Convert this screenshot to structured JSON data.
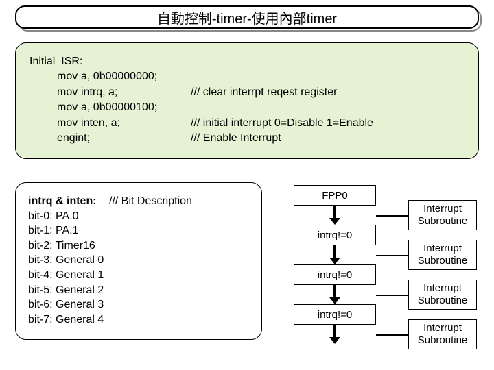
{
  "title": "自動控制-timer-使用內部timer",
  "code": {
    "label": "Initial_ISR:",
    "lines": [
      {
        "op": "mov",
        "arg": "a, 0b00000000;",
        "cmt": ""
      },
      {
        "op": "mov",
        "arg": "intrq, a;",
        "cmt": "/// clear interrpt reqest register"
      },
      {
        "op": "mov",
        "arg": "a, 0b00000100;",
        "cmt": ""
      },
      {
        "op": "mov",
        "arg": "inten, a;",
        "cmt": "/// initial interrupt 0=Disable 1=Enable"
      },
      {
        "op": "engint;",
        "arg": "",
        "cmt": "/// Enable Interrupt"
      }
    ]
  },
  "bits": {
    "heading_left": "intrq & inten:",
    "heading_right": "/// Bit Description",
    "rows": [
      "bit-0: PA.0",
      "bit-1: PA.1",
      "bit-2: Timer16",
      "bit-3: General 0",
      "bit-4: General 1",
      "bit-5: General 2",
      "bit-6: General 3",
      "bit-7: General 4"
    ]
  },
  "flow": {
    "top": "FPP0",
    "cond": "intrq!=0",
    "sub": "Interrupt Subroutine"
  }
}
